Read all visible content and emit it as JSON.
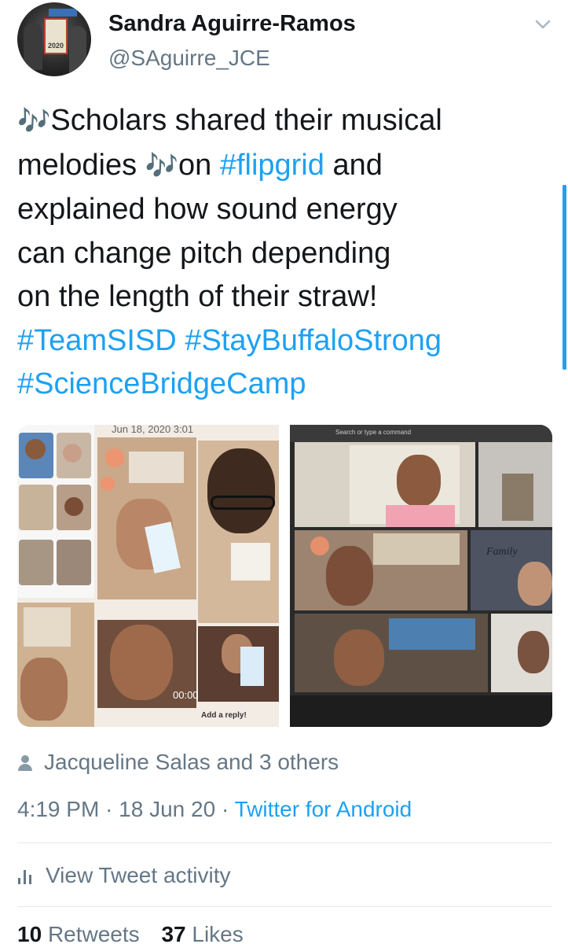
{
  "author": {
    "display_name": "Sandra Aguirre-Ramos",
    "handle": "@SAguirre_JCE",
    "avatar_sign_text": "2020"
  },
  "tweet": {
    "lines": [
      [
        {
          "t": "🎶",
          "k": "emoji"
        },
        {
          "t": "Scholars shared their musical",
          "k": "text"
        }
      ],
      [
        {
          "t": "melodies ",
          "k": "text"
        },
        {
          "t": "🎶",
          "k": "emoji"
        },
        {
          "t": "on ",
          "k": "text"
        },
        {
          "t": "#flipgrid",
          "k": "link"
        },
        {
          "t": " and",
          "k": "text"
        }
      ],
      [
        {
          "t": "explained how sound energy",
          "k": "text"
        }
      ],
      [
        {
          "t": "can change pitch depending",
          "k": "text"
        }
      ],
      [
        {
          "t": "on the length of their straw!",
          "k": "text"
        }
      ],
      [
        {
          "t": "#TeamSISD",
          "k": "link"
        },
        {
          "t": " ",
          "k": "text"
        },
        {
          "t": "#StayBuffaloStrong",
          "k": "link"
        }
      ],
      [
        {
          "t": "#ScienceBridgeCamp",
          "k": "link"
        }
      ]
    ]
  },
  "media": {
    "left": {
      "date_strip": "Jun 18, 2020 3:01",
      "video_time": "00:00",
      "reply_placeholder": "Add a reply!"
    },
    "right": {
      "search_bar": "Search or type a command",
      "sign_text": "Family"
    }
  },
  "engagement": {
    "likers": "Jacqueline Salas and 3 others",
    "time": "4:19 PM",
    "date": "18 Jun 20",
    "source": "Twitter for Android",
    "activity_label": "View Tweet activity",
    "retweets_count": "10",
    "retweets_label": "Retweets",
    "likes_count": "37",
    "likes_label": "Likes"
  },
  "colors": {
    "link": "#1da1f2",
    "secondary_text": "#657786",
    "primary_text": "#14171a",
    "divider": "#e1e8ed"
  },
  "icons": {
    "more": "chevron-down-icon",
    "likers": "person-icon",
    "activity": "bar-chart-icon",
    "music": "musical-notes-emoji"
  }
}
